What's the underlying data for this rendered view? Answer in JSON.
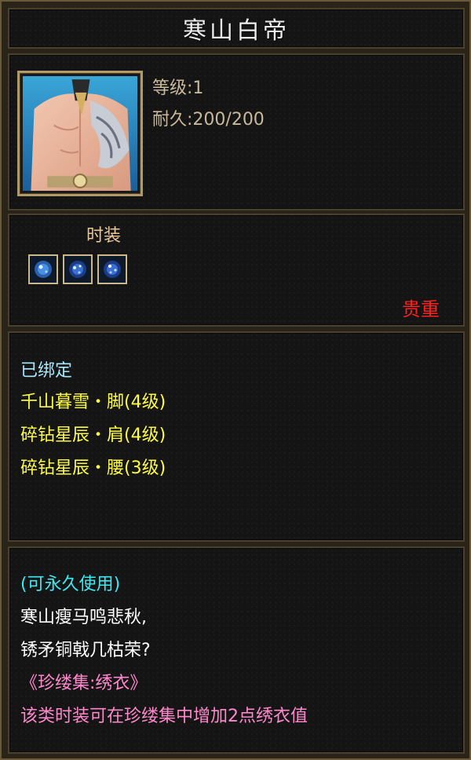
{
  "item": {
    "name": "寒山白帝",
    "level_text": "等级:1",
    "durability_text": "耐久:200/200",
    "type_label": "时装",
    "quality_label": "贵重"
  },
  "gems": [
    {
      "icon": "blue-gem-icon"
    },
    {
      "icon": "blue-gem-icon"
    },
    {
      "icon": "blue-gem-icon"
    }
  ],
  "binding": {
    "status": "已绑定",
    "sets": [
      "千山暮雪・脚(4级)",
      "碎钻星辰・肩(4级)",
      "碎钻星辰・腰(3级)"
    ]
  },
  "description": {
    "permanence": "(可永久使用)",
    "poem_line1": "寒山瘦马鸣悲秋,",
    "poem_line2": "锈矛铜戟几枯荣?",
    "collection": "《珍缕集:绣衣》",
    "effect": "该类时装可在珍缕集中增加2点绣衣值"
  },
  "colors": {
    "title": "#eeeeee",
    "stats": "#c9b99a",
    "type_label": "#e8c89a",
    "quality": "#ff2020",
    "bound": "#a8e8ff",
    "sets": "#ffff40",
    "permanence": "#40e8f0",
    "poem": "#ffffff",
    "collection": "#ff88cc"
  }
}
